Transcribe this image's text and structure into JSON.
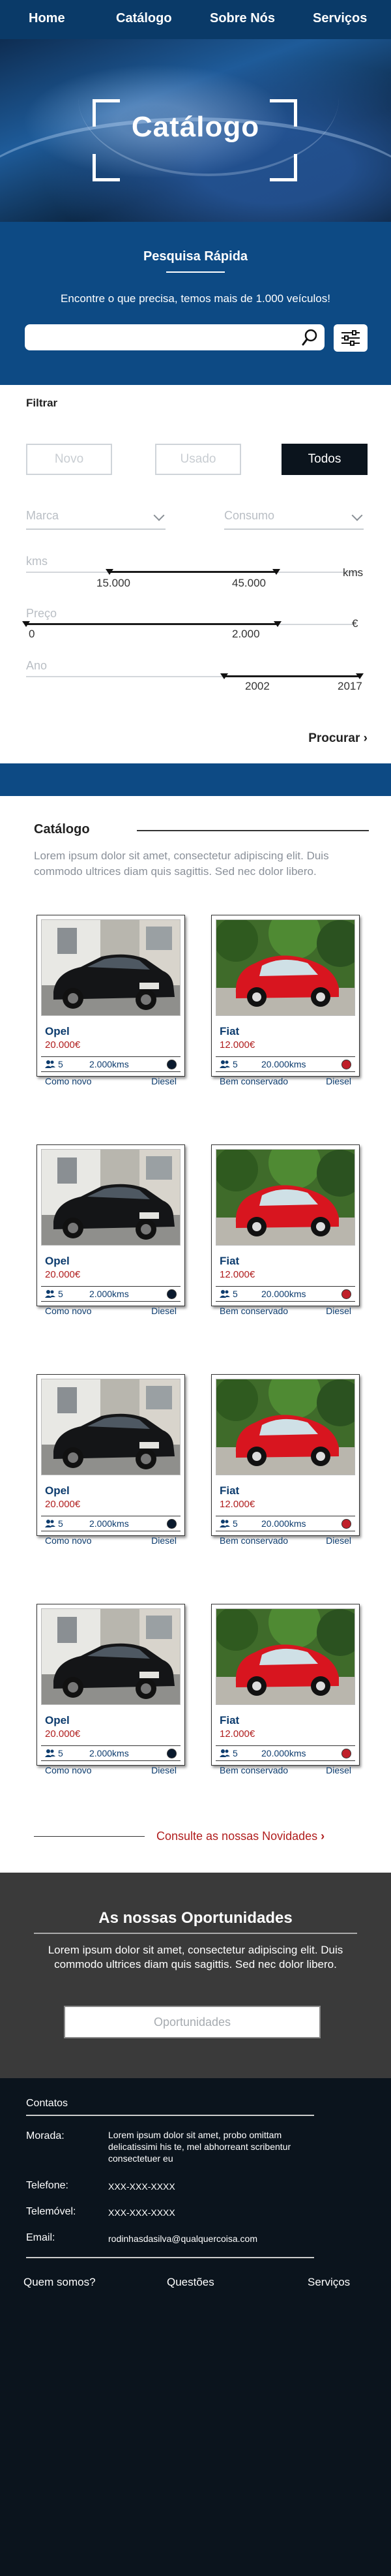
{
  "nav": {
    "items": [
      "Home",
      "Catálogo",
      "Sobre Nós",
      "Serviços"
    ]
  },
  "hero": {
    "title": "Catálogo"
  },
  "search": {
    "title": "Pesquisa Rápida",
    "subtitle": "Encontre o que precisa, temos mais de 1.000 veículos!",
    "placeholder": "",
    "search_icon": "search-icon",
    "filters_icon": "sliders-icon"
  },
  "filter": {
    "title": "Filtrar",
    "toggles": [
      "Novo",
      "Usado",
      "Todos"
    ],
    "selected_toggle": "Todos",
    "brand_placeholder": "Marca",
    "consumption_placeholder": "Consumo",
    "km": {
      "label": "kms",
      "min": "15.000",
      "max": "45.000",
      "unit": "kms",
      "range": [
        15000,
        45000
      ],
      "bounds": [
        0,
        60000
      ]
    },
    "price": {
      "label": "Preço",
      "min": "0",
      "max": "2.000",
      "unit": "€",
      "range": [
        0,
        2000
      ],
      "bounds": [
        0,
        2600
      ]
    },
    "year": {
      "label": "Ano",
      "min": "2002",
      "max": "2017",
      "range": [
        2002,
        2017
      ],
      "bounds": [
        1980,
        2017
      ]
    },
    "submit": "Procurar"
  },
  "catalog": {
    "title": "Catálogo",
    "intro": "Lorem ipsum dolor sit amet, consectetur adipiscing elit. Duis commodo ultrices diam quis sagittis. Sed nec dolor libero.",
    "cards": [
      {
        "name": "Opel",
        "price": "20.000€",
        "seats": "5",
        "km": "2.000kms",
        "condition": "Como novo",
        "fuel": "Diesel",
        "color": "#0a1a2e",
        "car": "black"
      },
      {
        "name": "Fiat",
        "price": "12.000€",
        "seats": "5",
        "km": "20.000kms",
        "condition": "Bem conservado",
        "fuel": "Diesel",
        "color": "#c0202a",
        "car": "red"
      },
      {
        "name": "Opel",
        "price": "20.000€",
        "seats": "5",
        "km": "2.000kms",
        "condition": "Como novo",
        "fuel": "Diesel",
        "color": "#0a1a2e",
        "car": "black"
      },
      {
        "name": "Fiat",
        "price": "12.000€",
        "seats": "5",
        "km": "20.000kms",
        "condition": "Bem conservado",
        "fuel": "Diesel",
        "color": "#c0202a",
        "car": "red"
      },
      {
        "name": "Opel",
        "price": "20.000€",
        "seats": "5",
        "km": "2.000kms",
        "condition": "Como novo",
        "fuel": "Diesel",
        "color": "#0a1a2e",
        "car": "black"
      },
      {
        "name": "Fiat",
        "price": "12.000€",
        "seats": "5",
        "km": "20.000kms",
        "condition": "Bem conservado",
        "fuel": "Diesel",
        "color": "#c0202a",
        "car": "red"
      },
      {
        "name": "Opel",
        "price": "20.000€",
        "seats": "5",
        "km": "2.000kms",
        "condition": "Como novo",
        "fuel": "Diesel",
        "color": "#0a1a2e",
        "car": "black"
      },
      {
        "name": "Fiat",
        "price": "12.000€",
        "seats": "5",
        "km": "20.000kms",
        "condition": "Bem conservado",
        "fuel": "Diesel",
        "color": "#c0202a",
        "car": "red"
      }
    ],
    "more_link": "Consulte as nossas Novidades"
  },
  "opportunities": {
    "title": "As nossas Oportunidades",
    "text": "Lorem ipsum dolor sit amet, consectetur adipiscing elit. Duis commodo ultrices diam quis sagittis. Sed nec dolor libero.",
    "button": "Oportunidades"
  },
  "footer": {
    "title": "Contatos",
    "address_label": "Morada:",
    "address": "Lorem ipsum dolor sit amet, probo omittam delicatissimi his te, mel abhorreant scribentur consectetuer eu",
    "phone_label": "Telefone:",
    "phone": "XXX-XXX-XXXX",
    "mobile_label": "Telemóvel:",
    "mobile": "XXX-XXX-XXXX",
    "email_label": "Email:",
    "email": "rodinhasdasilva@qualquercoisa.com",
    "links": [
      "Quem somos?",
      "Questões",
      "Serviços"
    ],
    "social": [
      "facebook-icon",
      "twitter-icon",
      "google-plus-icon"
    ]
  },
  "colors": {
    "primary": "#0d4a84",
    "nav": "#0a3a68",
    "accent": "#b01d1d",
    "dark": "#0b141d"
  }
}
